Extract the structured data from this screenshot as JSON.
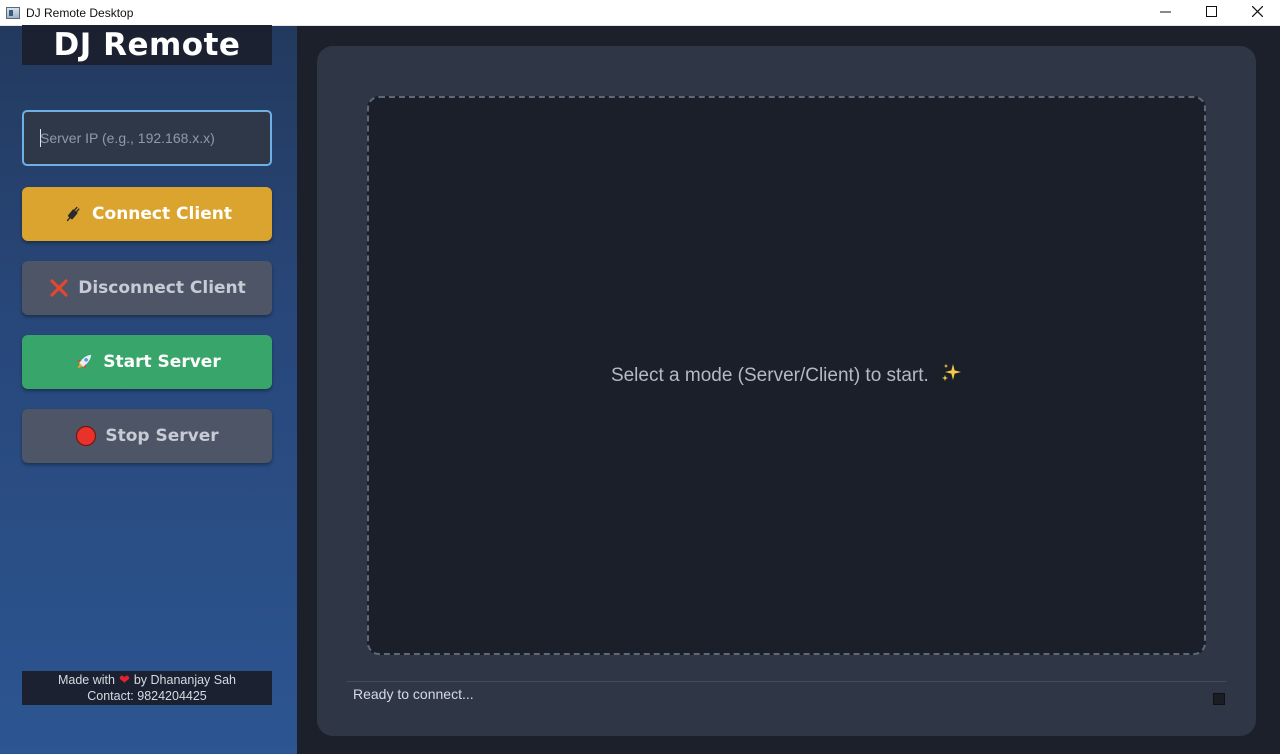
{
  "window": {
    "title": "DJ Remote Desktop",
    "controls": {
      "minimize": "minimize-icon",
      "maximize": "maximize-icon",
      "close": "close-icon"
    }
  },
  "sidebar": {
    "logo": "DJ Remote",
    "ip_input": {
      "value": "",
      "placeholder": "Server IP (e.g., 192.168.x.x)"
    },
    "buttons": {
      "connect": {
        "label": "Connect Client",
        "icon": "plug-icon",
        "color": "#dba42f"
      },
      "disconnect": {
        "label": "Disconnect Client",
        "icon": "cross-mark-icon",
        "color": "#4d5566"
      },
      "start": {
        "label": "Start Server",
        "icon": "rocket-icon",
        "color": "#38a56a"
      },
      "stop": {
        "label": "Stop Server",
        "icon": "red-circle-icon",
        "color": "#4d5566"
      }
    },
    "credits": {
      "made_with": "Made with",
      "by": "by Dhananjay Sah",
      "contact": "Contact: 9824204425"
    }
  },
  "main": {
    "prompt": "Select a mode (Server/Client) to start.",
    "prompt_icon": "sparkles-icon",
    "status": "Ready to connect..."
  }
}
